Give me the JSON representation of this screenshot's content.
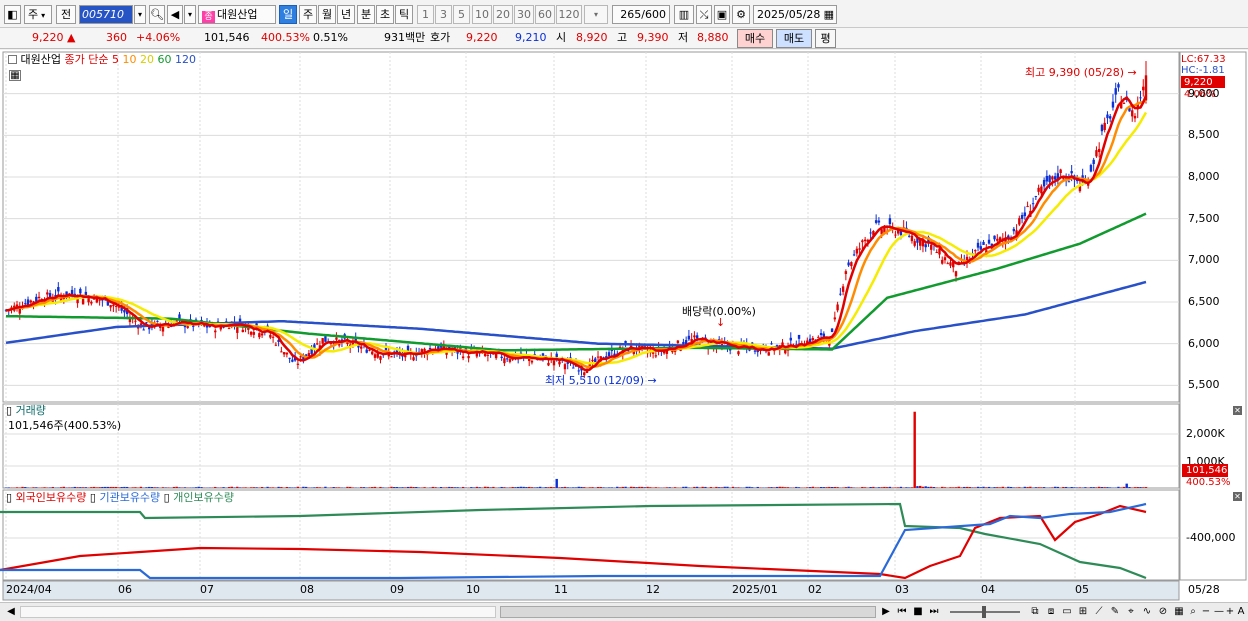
{
  "toolbar": {
    "market": "주",
    "prev_label": "전",
    "code": "005710",
    "stock_badge": "종",
    "stock_name": "대원산업",
    "periods": [
      "일",
      "주",
      "월",
      "년",
      "분",
      "초",
      "틱"
    ],
    "intervals": [
      "1",
      "3",
      "5",
      "10",
      "20",
      "30",
      "60",
      "120"
    ],
    "count": "265",
    "count_total": "/600",
    "date": "2025/05/28"
  },
  "quote": {
    "price": "9,220",
    "change": "360",
    "change_pct": "+4.06%",
    "volume": "101,546",
    "volume_pct": "400.53%",
    "turnover": "0.51%",
    "amount": "931백만",
    "bid_label": "호가",
    "bid1": "9,220",
    "bid2": "9,210",
    "open_label": "시",
    "open": "8,920",
    "high_label": "고",
    "high": "9,390",
    "low_label": "저",
    "low": "8,880",
    "buy_btn": "매수",
    "sell_btn": "매도",
    "eval_btn": "평"
  },
  "legend": {
    "stock": "대원산업",
    "close_simple": "종가 단순",
    "ma": [
      "5",
      "10",
      "20",
      "60",
      "120"
    ]
  },
  "price_panel": {
    "lc": "LC:67.33",
    "hc": "HC:-1.81",
    "current": "9,220",
    "current_pct": "4.06%",
    "high_note": "최고 9,390 (05/28)",
    "low_note": "최저 5,510 (12/09)",
    "dividend_note": "배당락(0.00%)",
    "yticks": [
      "9,000",
      "8,500",
      "8,000",
      "7,500",
      "7,000",
      "6,500",
      "6,000",
      "5,500"
    ]
  },
  "volume_panel": {
    "title": "거래량",
    "sub": "101,546주(400.53%)",
    "yticks": [
      "2,000K",
      "1,000K"
    ],
    "current": "101,546",
    "current_pct": "400.53%"
  },
  "holdings_panel": {
    "foreign": "외국인보유수량",
    "institution": "기관보유수량",
    "individual": "개인보유수량",
    "ytick": "-400,000"
  },
  "xaxis": [
    "2024/04",
    "06",
    "07",
    "08",
    "09",
    "10",
    "11",
    "12",
    "2025/01",
    "02",
    "03",
    "04",
    "05",
    "05/28"
  ],
  "colors": {
    "up": "#e00000",
    "down": "#0b30d8",
    "ma5": "#e00000",
    "ma10": "#ff8c00",
    "ma20": "#f5ec00",
    "ma60": "#119b2f",
    "ma120": "#2850c8",
    "foreign": "#e00000",
    "institution": "#2a6ad8",
    "individual": "#2e8b57"
  },
  "chart_data": {
    "type": "candlestick",
    "ylim": [
      5300,
      9500
    ],
    "months": [
      "2024/04",
      "06",
      "07",
      "08",
      "09",
      "10",
      "11",
      "12",
      "2025/01",
      "02",
      "03",
      "04",
      "05"
    ],
    "close_path": [
      [
        0,
        6400
      ],
      [
        12,
        6550
      ],
      [
        25,
        6600
      ],
      [
        38,
        6500
      ],
      [
        50,
        6200
      ],
      [
        62,
        6250
      ],
      [
        75,
        6200
      ],
      [
        82,
        6250
      ],
      [
        95,
        6150
      ],
      [
        105,
        5750
      ],
      [
        115,
        6050
      ],
      [
        125,
        6000
      ],
      [
        135,
        5900
      ],
      [
        145,
        5850
      ],
      [
        155,
        5950
      ],
      [
        165,
        5900
      ],
      [
        180,
        5850
      ],
      [
        200,
        5800
      ],
      [
        210,
        5700
      ],
      [
        218,
        5850
      ],
      [
        225,
        5950
      ],
      [
        236,
        5900
      ],
      [
        250,
        6050
      ],
      [
        265,
        5950
      ],
      [
        280,
        5950
      ],
      [
        294,
        6050
      ],
      [
        300,
        6100
      ],
      [
        305,
        6900
      ],
      [
        315,
        7400
      ],
      [
        325,
        7350
      ],
      [
        335,
        7200
      ],
      [
        345,
        6900
      ],
      [
        355,
        7150
      ],
      [
        365,
        7300
      ],
      [
        375,
        7800
      ],
      [
        383,
        8050
      ],
      [
        392,
        7900
      ],
      [
        398,
        8500
      ],
      [
        404,
        9000
      ],
      [
        410,
        8750
      ],
      [
        414,
        9220
      ]
    ],
    "ma120_path": [
      [
        0,
        6010
      ],
      [
        40,
        6200
      ],
      [
        100,
        6270
      ],
      [
        150,
        6180
      ],
      [
        215,
        6000
      ],
      [
        300,
        5940
      ],
      [
        330,
        6150
      ],
      [
        370,
        6350
      ],
      [
        414,
        6740
      ]
    ],
    "ma60_path": [
      [
        0,
        6330
      ],
      [
        60,
        6300
      ],
      [
        110,
        6120
      ],
      [
        180,
        5920
      ],
      [
        250,
        5950
      ],
      [
        300,
        5930
      ],
      [
        320,
        6550
      ],
      [
        360,
        6900
      ],
      [
        390,
        7200
      ],
      [
        414,
        7560
      ]
    ],
    "high_annotation": {
      "value": 9390,
      "date": "05/28"
    },
    "low_annotation": {
      "value": 5510,
      "date": "12/09"
    },
    "volume_ylim": [
      0,
      2500000
    ],
    "current_volume": 101546,
    "volume_spikes": [
      [
        200,
        270000
      ],
      [
        330,
        2270000
      ],
      [
        407,
        130000
      ]
    ]
  }
}
